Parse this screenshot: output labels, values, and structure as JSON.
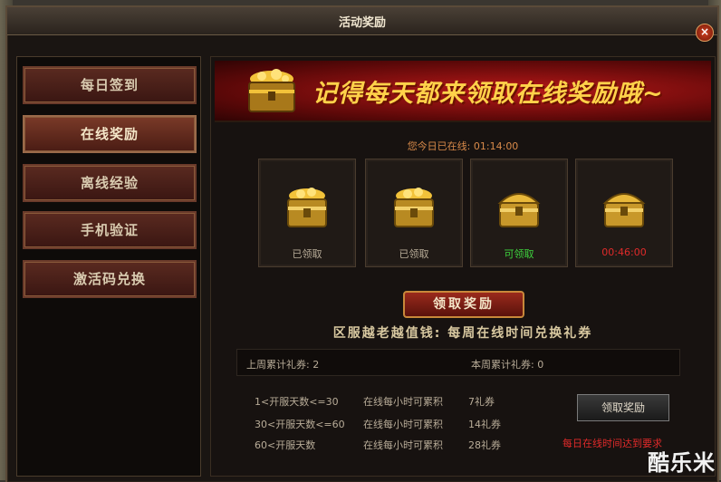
{
  "window": {
    "title": "活动奖励",
    "close_label": "×"
  },
  "sidebar": {
    "items": [
      {
        "label": "每日签到"
      },
      {
        "label": "在线奖励"
      },
      {
        "label": "离线经验"
      },
      {
        "label": "手机验证"
      },
      {
        "label": "激活码兑换"
      }
    ]
  },
  "banner": {
    "text": "记得每天都来领取在线奖励哦~"
  },
  "online": {
    "label": "您今日已在线:",
    "time": "01:14:00"
  },
  "rewards": [
    {
      "status": "已领取",
      "state": "claimed"
    },
    {
      "status": "已领取",
      "state": "claimed"
    },
    {
      "status": "可领取",
      "state": "available"
    },
    {
      "status": "00:46:00",
      "state": "countdown"
    }
  ],
  "claim_button": "领取奖励",
  "slogan": "区服越老越值钱: 每周在线时间兑换礼券",
  "coupons": {
    "last_week_label": "上周累计礼券:",
    "last_week_value": "2",
    "this_week_label": "本周累计礼券:",
    "this_week_value": "0"
  },
  "rules": [
    {
      "range": "1<开服天数<=30",
      "desc": "在线每小时可累积",
      "reward": "7礼券"
    },
    {
      "range": "30<开服天数<=60",
      "desc": "在线每小时可累积",
      "reward": "14礼券"
    },
    {
      "range": "60<开服天数",
      "desc": "在线每小时可累积",
      "reward": "28礼券"
    }
  ],
  "exchange_button": "领取奖励",
  "requirement_text": "每日在线时间达到要求",
  "watermark": "酷乐米",
  "colors": {
    "gold": "#ffd24a",
    "status_green": "#3ed33e",
    "status_red": "#e02a2a",
    "online_orange": "#d88a4a"
  }
}
